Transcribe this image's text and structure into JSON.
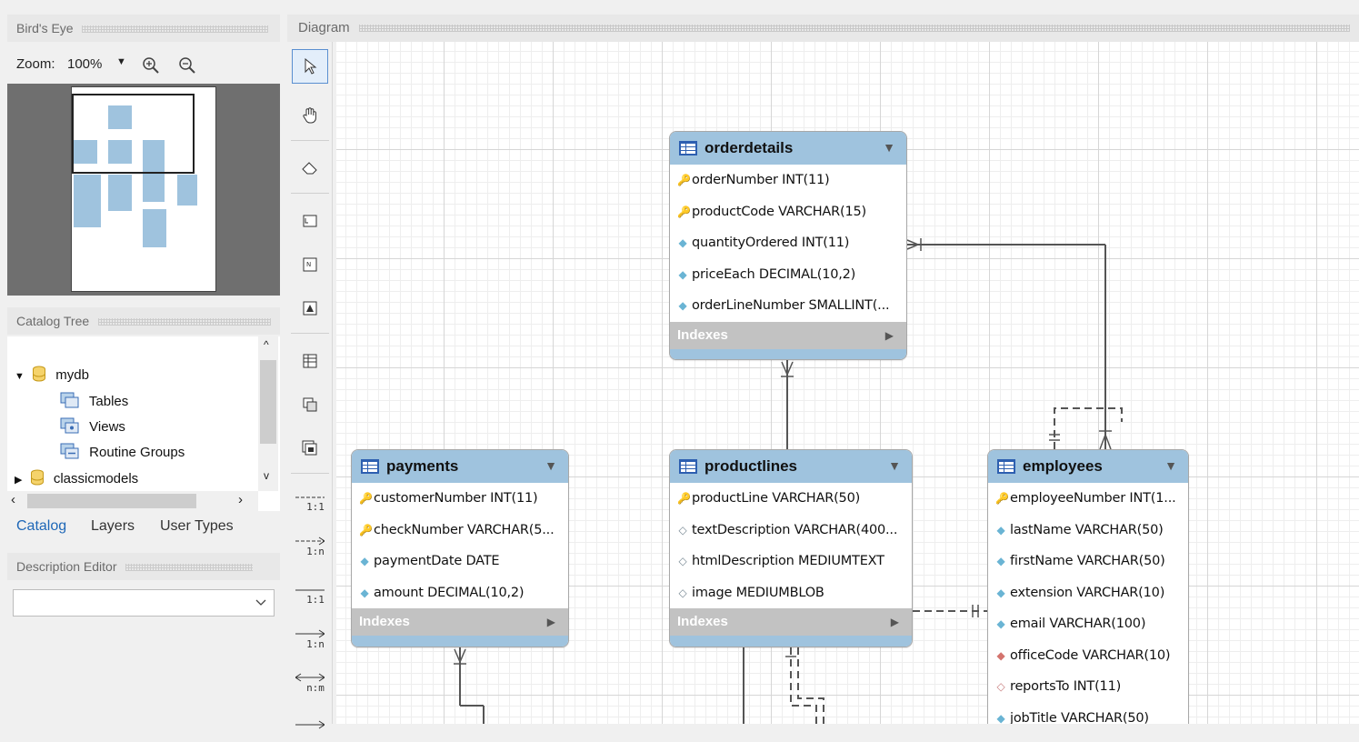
{
  "left_panel": {
    "birds_eye_title": "Bird's Eye",
    "zoom_label": "Zoom:",
    "zoom_value": "100%",
    "catalog_tree_title": "Catalog Tree",
    "tree": {
      "db1": "mydb",
      "db1_children": [
        "Tables",
        "Views",
        "Routine Groups"
      ],
      "db2": "classicmodels"
    },
    "tabs": [
      "Catalog",
      "Layers",
      "User Types"
    ],
    "description_editor_title": "Description Editor"
  },
  "diagram": {
    "title": "Diagram",
    "toolbar": {
      "rel_1_1": "1:1",
      "rel_1_n": "1:n",
      "rel_1_1b": "1:1",
      "rel_1_nb": "1:n",
      "rel_n_m": "n:m"
    },
    "indexes_label": "Indexes",
    "tables": {
      "orderdetails": {
        "name": "orderdetails",
        "columns": [
          "orderNumber INT(11)",
          "productCode VARCHAR(15)",
          "quantityOrdered INT(11)",
          "priceEach DECIMAL(10,2)",
          "orderLineNumber SMALLINT(..."
        ]
      },
      "payments": {
        "name": "payments",
        "columns": [
          "customerNumber INT(11)",
          "checkNumber VARCHAR(5...",
          "paymentDate DATE",
          "amount DECIMAL(10,2)"
        ]
      },
      "productlines": {
        "name": "productlines",
        "columns": [
          "productLine VARCHAR(50)",
          "textDescription VARCHAR(400...",
          "htmlDescription MEDIUMTEXT",
          "image MEDIUMBLOB"
        ]
      },
      "employees": {
        "name": "employees",
        "columns": [
          "employeeNumber INT(1...",
          "lastName VARCHAR(50)",
          "firstName VARCHAR(50)",
          "extension VARCHAR(10)",
          "email VARCHAR(100)",
          "officeCode VARCHAR(10)",
          "reportsTo INT(11)",
          "jobTitle VARCHAR(50)"
        ]
      }
    }
  },
  "colors": {
    "table_header": "#9fc3de",
    "indexes_bar": "#c2c2c2",
    "active_tab": "#1e67b7"
  }
}
